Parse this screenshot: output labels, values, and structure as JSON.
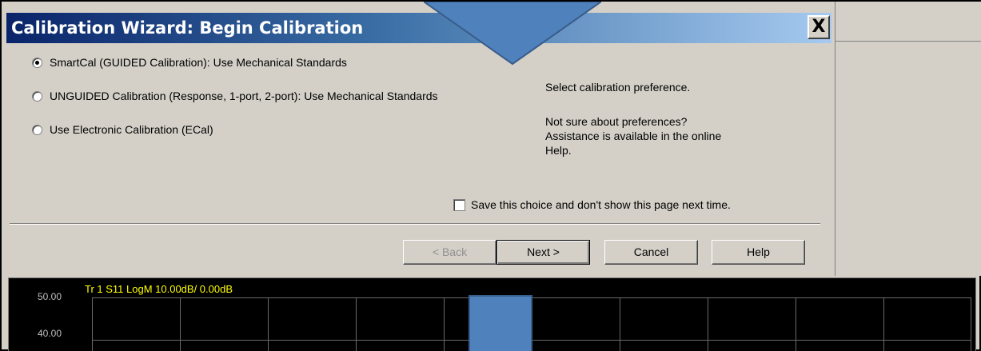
{
  "dialog": {
    "title": "Calibration Wizard: Begin Calibration",
    "close_glyph": "X",
    "options": [
      {
        "label": "SmartCal (GUIDED Calibration): Use Mechanical Standards",
        "selected": true
      },
      {
        "label": "UNGUIDED Calibration (Response, 1-port, 2-port): Use Mechanical Standards",
        "selected": false
      },
      {
        "label": "Use Electronic Calibration (ECal)",
        "selected": false
      }
    ],
    "info": {
      "prompt": "Select calibration preference.",
      "help_line1": "Not sure about preferences?",
      "help_line2": "Assistance is available in the online",
      "help_line3": "Help."
    },
    "save_choice_label": "Save this choice and don't show this page next time.",
    "save_choice_checked": false,
    "buttons": {
      "back": "< Back",
      "next": "Next >",
      "cancel": "Cancel",
      "help": "Help"
    }
  },
  "trace": {
    "label": "Tr 1  S11 LogM 10.00dB/ 0.00dB",
    "y_ticks": [
      "50.00",
      "40.00"
    ]
  },
  "colors": {
    "title_gradient_start": "#0a246a",
    "annotation_fill": "#4f81bd",
    "trace_label": "#ffff00"
  }
}
